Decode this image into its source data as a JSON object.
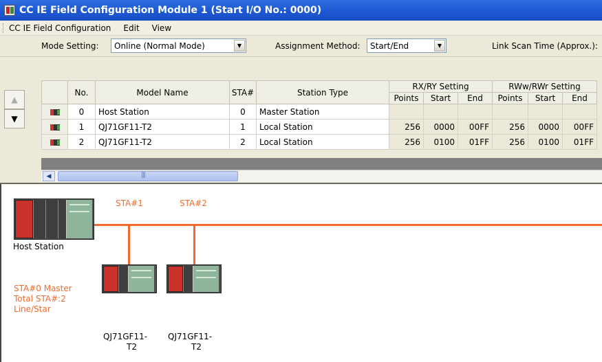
{
  "window": {
    "title": "CC IE Field Configuration Module 1 (Start I/O No.: 0000)"
  },
  "menu": {
    "items": [
      {
        "label": "CC IE Field Configuration"
      },
      {
        "label": "Edit"
      },
      {
        "label": "View"
      }
    ]
  },
  "settings": {
    "mode_label": "Mode Setting:",
    "mode_value": "Online (Normal Mode)",
    "assign_label": "Assignment Method:",
    "assign_value": "Start/End",
    "linkscan_label": "Link Scan Time (Approx.):"
  },
  "table": {
    "headers": {
      "no": "No.",
      "model": "Model Name",
      "sta": "STA#",
      "type": "Station Type",
      "rxry": "RX/RY Setting",
      "rwwrwr": "RWw/RWr Setting",
      "points": "Points",
      "start": "Start",
      "end": "End"
    },
    "rows": [
      {
        "no": "0",
        "model": "Host Station",
        "sta": "0",
        "type": "Master Station",
        "rx_points": "",
        "rx_start": "",
        "rx_end": "",
        "rw_points": "",
        "rw_start": "",
        "rw_end": ""
      },
      {
        "no": "1",
        "model": "QJ71GF11-T2",
        "sta": "1",
        "type": "Local Station",
        "rx_points": "256",
        "rx_start": "0000",
        "rx_end": "00FF",
        "rw_points": "256",
        "rw_start": "0000",
        "rw_end": "00FF"
      },
      {
        "no": "2",
        "model": "QJ71GF11-T2",
        "sta": "2",
        "type": "Local Station",
        "rx_points": "256",
        "rx_start": "0100",
        "rx_end": "01FF",
        "rw_points": "256",
        "rw_start": "0100",
        "rw_end": "01FF"
      }
    ]
  },
  "diagram": {
    "sta1": "STA#1",
    "sta2": "STA#2",
    "host_label": "Host Station",
    "info_line1": "STA#0  Master",
    "info_line2": "Total STA#:2",
    "info_line3": "Line/Star",
    "module1_line1": "QJ71GF11-",
    "module1_line2": "T2",
    "module2_line1": "QJ71GF11-",
    "module2_line2": "T2"
  },
  "colors": {
    "accent": "#f26a2e",
    "titlebar": "#1c58d3"
  }
}
